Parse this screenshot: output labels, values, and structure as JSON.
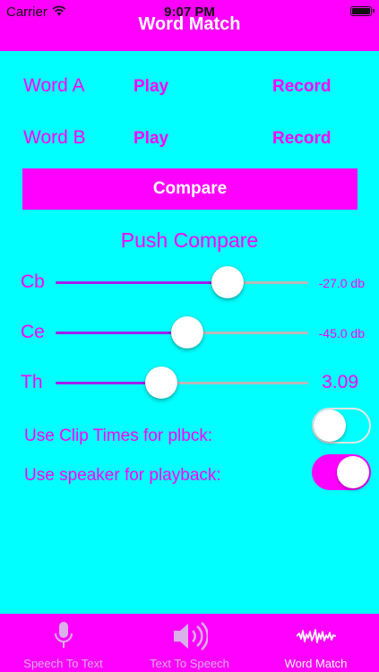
{
  "status_bar": {
    "carrier": "Carrier",
    "time": "9:07 PM"
  },
  "header": {
    "title": "Word Match"
  },
  "words": [
    {
      "label": "Word A",
      "play_label": "Play",
      "record_label": "Record"
    },
    {
      "label": "Word B",
      "play_label": "Play",
      "record_label": "Record"
    }
  ],
  "compare_button": {
    "label": "Compare"
  },
  "status_message": "Push Compare",
  "sliders": [
    {
      "label": "Cb",
      "value_text": "-27.0 db",
      "level": 0.68
    },
    {
      "label": "Ce",
      "value_text": "-45.0 db",
      "level": 0.52
    },
    {
      "label": "Th",
      "value_text": "3.09",
      "level": 0.42
    }
  ],
  "toggles": [
    {
      "label": "Use Clip Times for plbck:",
      "on": false
    },
    {
      "label": "Use speaker for playback:",
      "on": true
    }
  ],
  "tabs": [
    {
      "label": "Speech To Text",
      "icon": "microphone-icon",
      "selected": false
    },
    {
      "label": "Text To Speech",
      "icon": "speaker-icon",
      "selected": false
    },
    {
      "label": "Word Match",
      "icon": "waveform-icon",
      "selected": true
    }
  ],
  "colors": {
    "background": "#00FFFF",
    "accent": "#FF00FF",
    "slider_fill": "#A020F0"
  }
}
